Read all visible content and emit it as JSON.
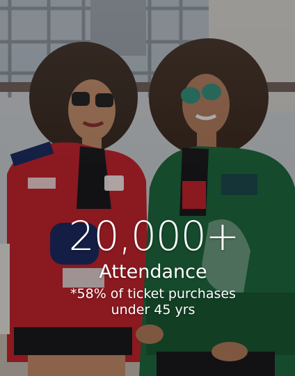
{
  "stat": {
    "number": "20,000+",
    "label": "Attendance",
    "note_line1": "*58% of ticket purchases",
    "note_line2": "under 45 yrs"
  },
  "colors": {
    "overlay": "#000000",
    "text": "#ffffff",
    "jacket_left": "#c8242f",
    "jacket_right": "#1f6b3f"
  },
  "background": {
    "icon": "photo-two-women-in-racing-jackets"
  }
}
